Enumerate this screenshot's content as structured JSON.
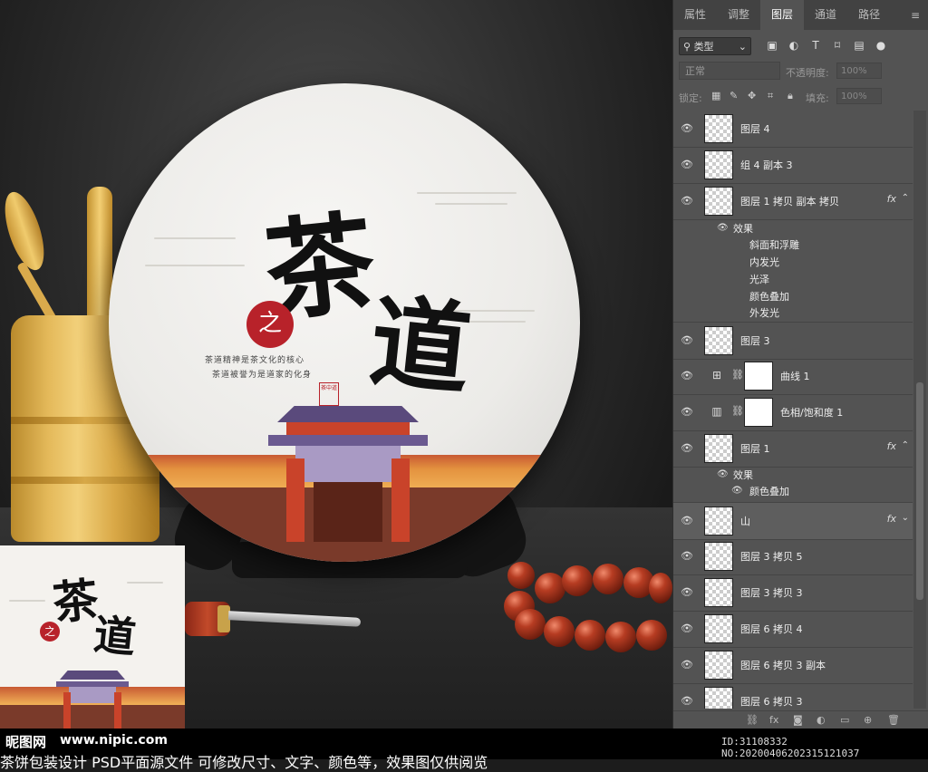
{
  "panel": {
    "tabs": [
      "属性",
      "调整",
      "图层",
      "通道",
      "路径"
    ],
    "active_tab": "图层",
    "filter": {
      "label": "类型",
      "icons": [
        "image-filter-icon",
        "adjustment-filter-icon",
        "type-filter-icon",
        "shape-filter-icon",
        "smart-object-filter-icon",
        "toggle-filter-icon"
      ]
    },
    "blend_mode": "正常",
    "opacity_label": "不透明度:",
    "opacity_value": "100%",
    "lock_label": "锁定:",
    "fill_label": "填充:",
    "fill_value": "100%",
    "layers": [
      {
        "name": "图层 4"
      },
      {
        "name": "组 4 副本 3"
      },
      {
        "name": "图层 1 拷贝 副本 拷贝",
        "fx": "fx"
      },
      {
        "name": "图层 3"
      },
      {
        "name": "曲线 1"
      },
      {
        "name": "色相/饱和度 1"
      },
      {
        "name": "图层 1",
        "fx": "fx"
      },
      {
        "name": "山",
        "fx": "fx"
      },
      {
        "name": "图层 3 拷贝 5"
      },
      {
        "name": "图层 3 拷贝 3"
      },
      {
        "name": "图层 6 拷贝 4"
      },
      {
        "name": "图层 6 拷贝 3 副本"
      },
      {
        "name": "图层 6 拷贝 3"
      }
    ],
    "effects_a": {
      "title": "效果",
      "items": [
        "斜面和浮雕",
        "内发光",
        "光泽",
        "颜色叠加",
        "外发光"
      ]
    },
    "effects_b": {
      "title": "效果",
      "items": [
        "颜色叠加"
      ]
    }
  },
  "artwork": {
    "title_char1": "茶",
    "title_char2": "道",
    "seal_char": "之",
    "poem_line1": "茶道精神是茶文化的核心",
    "poem_line2": "茶道被誉为是道家的化身",
    "stamp_text": "茶中道"
  },
  "footer": {
    "logo": "昵图网",
    "url": "www.nipic.com",
    "id_text": "ID:31108332 NO:20200406202315121037",
    "description": "茶饼包装设计 PSD平面源文件 可修改尺寸、文字、颜色等，效果图仅供阅览"
  }
}
